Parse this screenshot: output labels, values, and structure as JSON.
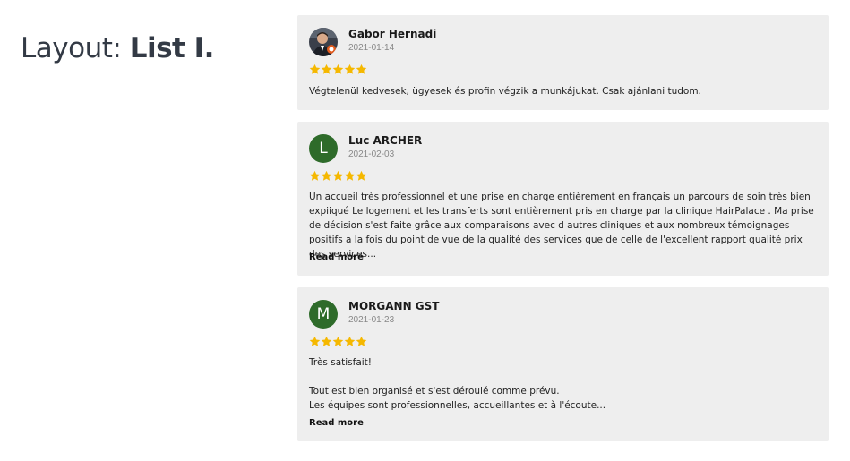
{
  "page": {
    "heading_prefix": "Layout: ",
    "heading_bold": "List I."
  },
  "colors": {
    "star": "#f5b800",
    "avatar_bg": "#2e6b2a",
    "card_bg": "#eeeeee"
  },
  "reviews": [
    {
      "name": "Gabor Hernadi",
      "date": "2021-01-14",
      "avatar": "photo",
      "rating": 5,
      "text": "Végtelenül kedvesek, ügyesek és profin végzik a munkájukat. Csak ajánlani tudom."
    },
    {
      "name": "Luc ARCHER",
      "date": "2021-02-03",
      "avatar_letter": "L",
      "rating": 5,
      "text": "Un accueil très professionnel et une prise en charge entièrement en français un parcours de soin très bien expiiqué Le logement et les transferts sont entièrement pris en charge par la clinique HairPalace . Ma prise de décision s'est faite grâce aux comparaisons avec d autres cliniques et aux nombreux témoignages positifs a la fois du point de vue de la qualité des services que de celle de l'excellent rapport qualité prix des services...",
      "read_more": "Read more"
    },
    {
      "name": "MORGANN GST",
      "date": "2021-01-23",
      "avatar_letter": "M",
      "rating": 5,
      "text": "Très satisfait!\n\nTout est bien organisé et s'est déroulé comme prévu.\nLes équipes sont professionnelles, accueillantes et à l'écoute...",
      "read_more": "Read more"
    }
  ]
}
